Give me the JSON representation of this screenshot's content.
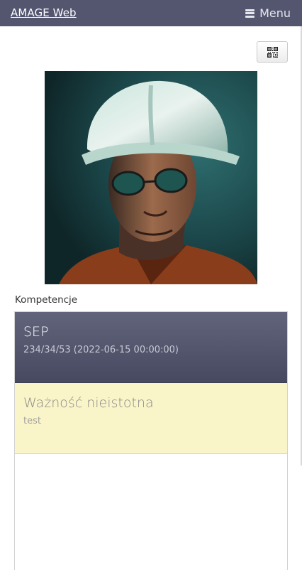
{
  "header": {
    "brand": "AMAGE Web",
    "menu_label": "Menu",
    "menu_icon": "hamburger-icon",
    "background": "#545670"
  },
  "toolbar": {
    "qr_icon": "qr-code-icon"
  },
  "profile": {
    "photo": "portrait-photo"
  },
  "competences": {
    "section_label": "Kompetencje",
    "items": [
      {
        "title": "SEP",
        "detail": "234/34/53 (2022-06-15 00:00:00)",
        "color": "#545670"
      },
      {
        "title": "Ważność nieistotna",
        "detail": "test",
        "color": "#faf5c8"
      }
    ]
  }
}
